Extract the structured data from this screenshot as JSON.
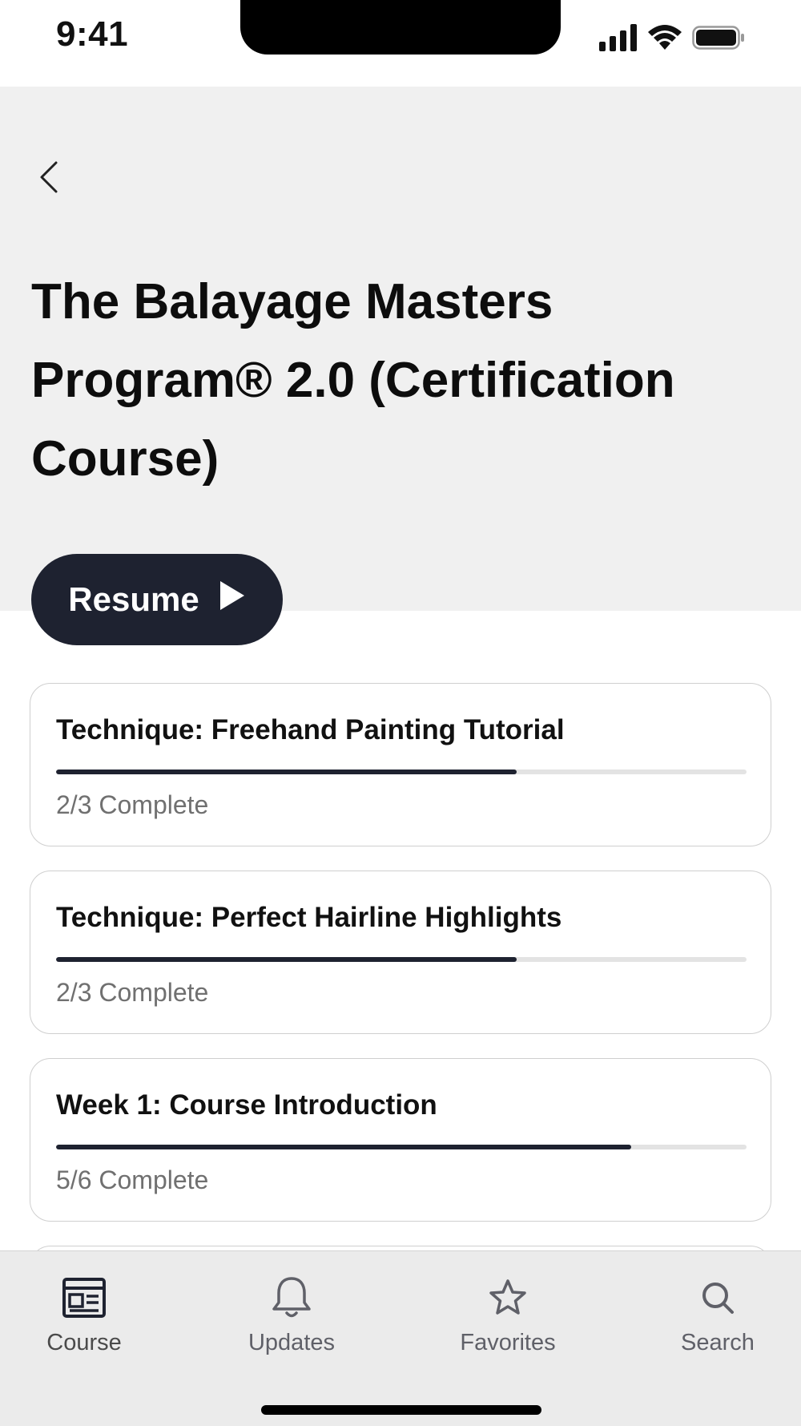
{
  "status_bar": {
    "time": "9:41"
  },
  "header": {
    "back_icon": "chevron-left-icon",
    "title": "The Balayage Masters Program® 2.0 (Certification Course)",
    "background": "#f0f0f0"
  },
  "resume": {
    "label": "Resume",
    "icon": "play-icon",
    "color": "#1e2230"
  },
  "modules": [
    {
      "title": "Technique: Freehand Painting Tutorial",
      "status": "2/3 Complete",
      "progress": 0.667
    },
    {
      "title": "Technique: Perfect Hairline Highlights",
      "status": "2/3 Complete",
      "progress": 0.667
    },
    {
      "title": "Week 1: Course Introduction",
      "status": "5/6 Complete",
      "progress": 0.833
    }
  ],
  "tabs": [
    {
      "label": "Course",
      "icon": "course-icon",
      "active": true
    },
    {
      "label": "Updates",
      "icon": "bell-icon",
      "active": false
    },
    {
      "label": "Favorites",
      "icon": "star-icon",
      "active": false
    },
    {
      "label": "Search",
      "icon": "search-icon",
      "active": false
    }
  ]
}
